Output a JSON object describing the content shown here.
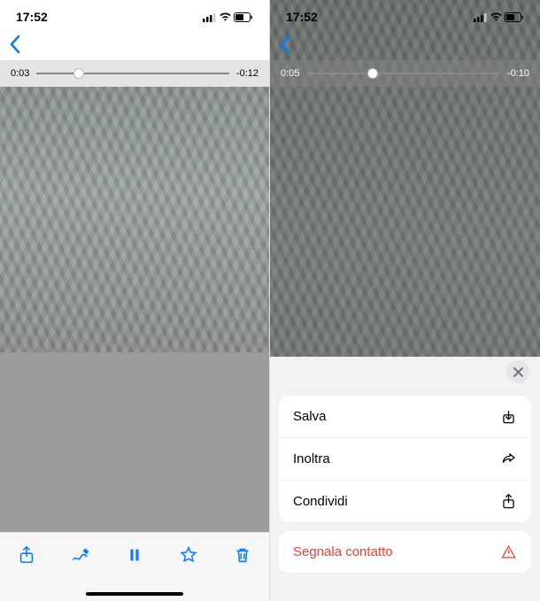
{
  "left": {
    "time": "17:52",
    "scrub": {
      "elapsed": "0:03",
      "remaining": "-0:12",
      "pct": 22
    }
  },
  "right": {
    "time": "17:52",
    "scrub": {
      "elapsed": "0:05",
      "remaining": "-0:10",
      "pct": 34
    },
    "menu": {
      "save": "Salva",
      "forward": "Inoltra",
      "share": "Condividi",
      "report": "Segnala contatto"
    }
  }
}
